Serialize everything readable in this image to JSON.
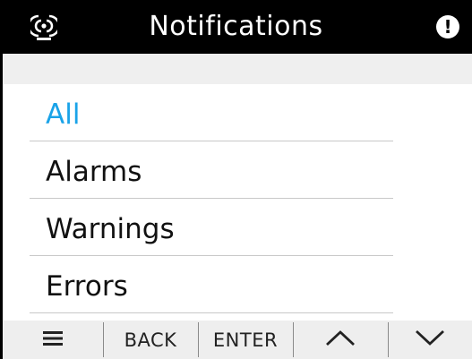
{
  "header": {
    "title": "Notifications",
    "connection_icon": "connection-status-icon",
    "alert_icon": "alert-icon",
    "alert_glyph": "!"
  },
  "menu": {
    "items": [
      {
        "label": "All",
        "active": true
      },
      {
        "label": "Alarms",
        "active": false
      },
      {
        "label": "Warnings",
        "active": false
      },
      {
        "label": "Errors",
        "active": false
      }
    ]
  },
  "toolbar": {
    "menu_icon": "hamburger-menu-icon",
    "back_label": "BACK",
    "enter_label": "ENTER",
    "up_icon": "chevron-up-icon",
    "down_icon": "chevron-down-icon"
  },
  "colors": {
    "header_bg": "#000000",
    "active_item": "#1aa3e8",
    "toolbar_bg": "#eeeeee",
    "subbar_bg": "#efefef"
  }
}
